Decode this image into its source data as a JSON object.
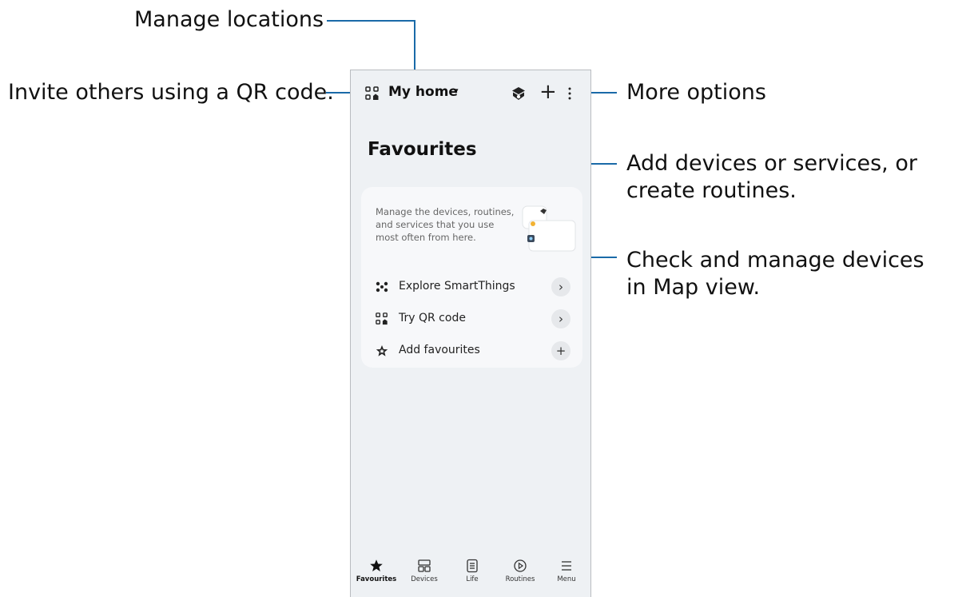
{
  "callouts": {
    "manage_locations": "Manage locations",
    "invite_qr": "Invite others using a QR code.",
    "more_options": "More options",
    "add_devices": "Add devices or services, or create routines.",
    "map_view": "Check and manage devices in Map view."
  },
  "header": {
    "location": "My home",
    "caret": "▾",
    "add": "+"
  },
  "page": {
    "title": "Favourites"
  },
  "card": {
    "description": "Manage the devices, routines, and services that you use most often from here.",
    "items": [
      {
        "label": "Explore SmartThings",
        "action": "›",
        "icon": "smartthings-icon"
      },
      {
        "label": "Try QR code",
        "action": "›",
        "icon": "qr-code-icon"
      },
      {
        "label": "Add favourites",
        "action": "+",
        "icon": "star-outline-icon"
      }
    ]
  },
  "bottom_nav": [
    {
      "label": "Favourites",
      "icon": "star-icon",
      "active": true
    },
    {
      "label": "Devices",
      "icon": "devices-icon",
      "active": false
    },
    {
      "label": "Life",
      "icon": "life-icon",
      "active": false
    },
    {
      "label": "Routines",
      "icon": "routines-icon",
      "active": false
    },
    {
      "label": "Menu",
      "icon": "menu-icon",
      "active": false
    }
  ],
  "colors": {
    "leader_line": "#1a6aa8",
    "screen_bg": "#eef1f4",
    "card_bg": "#f7f8fa"
  }
}
